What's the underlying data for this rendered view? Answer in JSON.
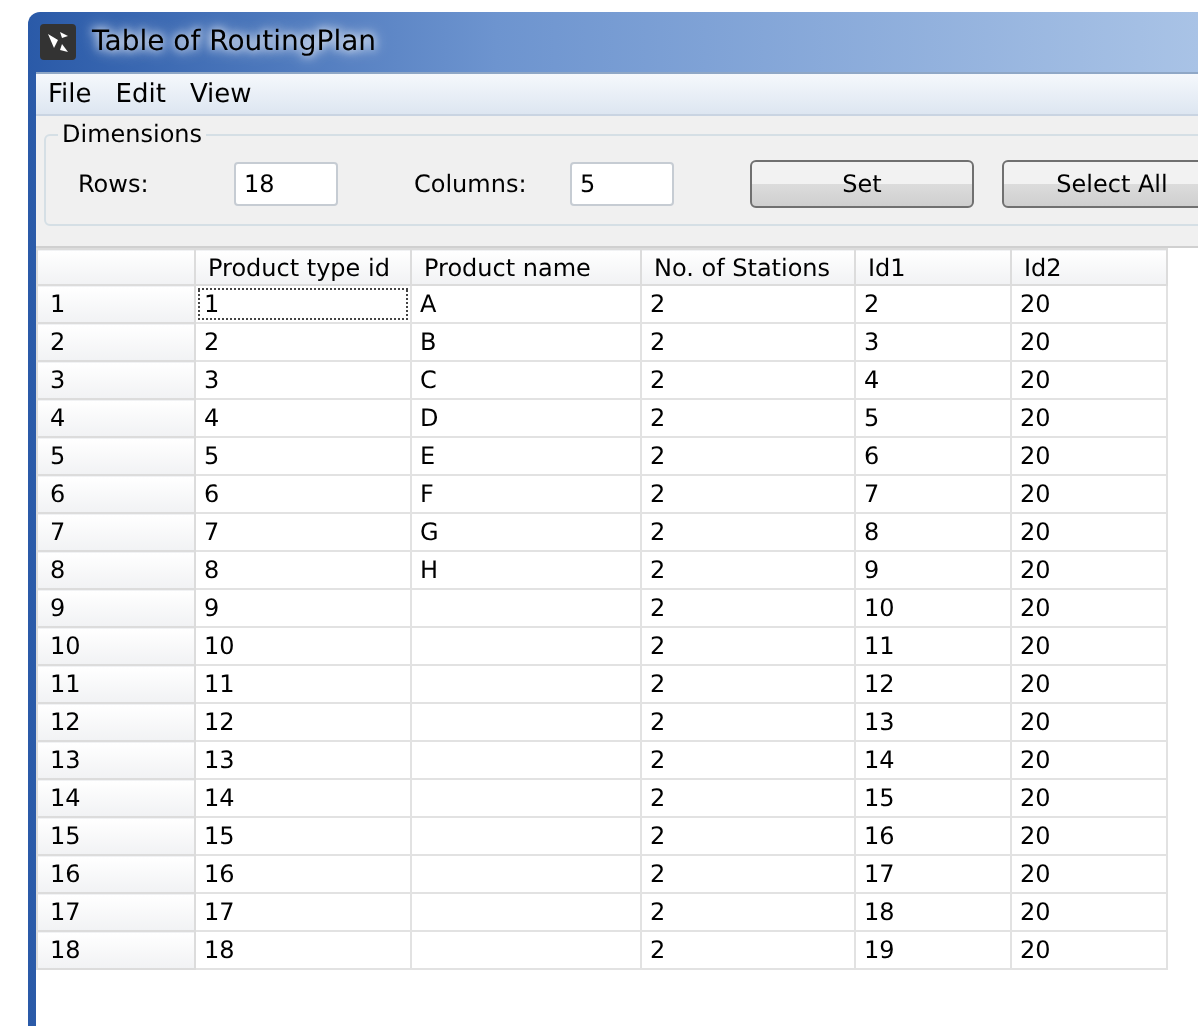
{
  "window": {
    "title": "Table of RoutingPlan"
  },
  "menu": [
    "File",
    "Edit",
    "View"
  ],
  "dimensions": {
    "title": "Dimensions",
    "fields": [
      {
        "label": "Rows:",
        "value": "18"
      },
      {
        "label": "Columns:",
        "value": "5"
      }
    ],
    "buttons": [
      "Set",
      "Select All"
    ]
  },
  "table": {
    "columns": [
      "Product type id",
      "Product name",
      "No. of Stations",
      "Id1",
      "Id2"
    ],
    "rows": [
      {
        "label": "1",
        "focused": true,
        "cells": [
          "1",
          "A",
          "2",
          "2",
          "20"
        ]
      },
      {
        "label": "2",
        "focused": false,
        "cells": [
          "2",
          "B",
          "2",
          "3",
          "20"
        ]
      },
      {
        "label": "3",
        "focused": false,
        "cells": [
          "3",
          "C",
          "2",
          "4",
          "20"
        ]
      },
      {
        "label": "4",
        "focused": false,
        "cells": [
          "4",
          "D",
          "2",
          "5",
          "20"
        ]
      },
      {
        "label": "5",
        "focused": false,
        "cells": [
          "5",
          "E",
          "2",
          "6",
          "20"
        ]
      },
      {
        "label": "6",
        "focused": false,
        "cells": [
          "6",
          "F",
          "2",
          "7",
          "20"
        ]
      },
      {
        "label": "7",
        "focused": false,
        "cells": [
          "7",
          "G",
          "2",
          "8",
          "20"
        ]
      },
      {
        "label": "8",
        "focused": false,
        "cells": [
          "8",
          "H",
          "2",
          "9",
          "20"
        ]
      },
      {
        "label": "9",
        "focused": false,
        "cells": [
          "9",
          "",
          "2",
          "10",
          "20"
        ]
      },
      {
        "label": "10",
        "focused": false,
        "cells": [
          "10",
          "",
          "2",
          "11",
          "20"
        ]
      },
      {
        "label": "11",
        "focused": false,
        "cells": [
          "11",
          "",
          "2",
          "12",
          "20"
        ]
      },
      {
        "label": "12",
        "focused": false,
        "cells": [
          "12",
          "",
          "2",
          "13",
          "20"
        ]
      },
      {
        "label": "13",
        "focused": false,
        "cells": [
          "13",
          "",
          "2",
          "14",
          "20"
        ]
      },
      {
        "label": "14",
        "focused": false,
        "cells": [
          "14",
          "",
          "2",
          "15",
          "20"
        ]
      },
      {
        "label": "15",
        "focused": false,
        "cells": [
          "15",
          "",
          "2",
          "16",
          "20"
        ]
      },
      {
        "label": "16",
        "focused": false,
        "cells": [
          "16",
          "",
          "2",
          "17",
          "20"
        ]
      },
      {
        "label": "17",
        "focused": false,
        "cells": [
          "17",
          "",
          "2",
          "18",
          "20"
        ]
      },
      {
        "label": "18",
        "focused": false,
        "cells": [
          "18",
          "",
          "2",
          "19",
          "20"
        ]
      }
    ]
  }
}
